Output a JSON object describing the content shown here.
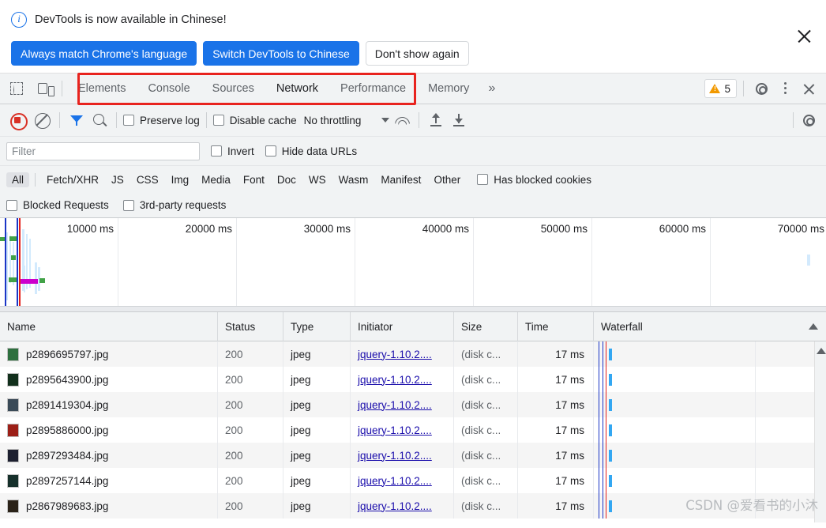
{
  "banner": {
    "message": "DevTools is now available in Chinese!",
    "info_icon": "info-icon",
    "primary_button": "Always match Chrome's language",
    "secondary_button": "Switch DevTools to Chinese",
    "dismiss_button": "Don't show again",
    "close_icon": "close-icon"
  },
  "tabbar": {
    "inspect_icon": "inspect-element-icon",
    "device_icon": "device-toolbar-icon",
    "tabs": [
      {
        "label": "Elements",
        "active": false
      },
      {
        "label": "Console",
        "active": false
      },
      {
        "label": "Sources",
        "active": false
      },
      {
        "label": "Network",
        "active": true
      },
      {
        "label": "Performance",
        "active": false
      },
      {
        "label": "Memory",
        "active": false
      }
    ],
    "more_tabs": "»",
    "warning_count": "5",
    "warning_icon": "warning-triangle-icon",
    "settings_icon": "gear-icon",
    "menu_icon": "kebab-menu-icon",
    "close_icon": "close-icon"
  },
  "network_toolbar": {
    "record_icon": "record-button-icon",
    "clear_icon": "clear-icon",
    "filter_icon": "filter-funnel-icon",
    "search_icon": "search-icon",
    "preserve_log": "Preserve log",
    "disable_cache": "Disable cache",
    "throttling": "No throttling",
    "throttle_caret": "chevron-down-icon",
    "network_conditions_icon": "wifi-icon",
    "import_icon": "import-har-icon",
    "export_icon": "export-har-icon",
    "settings_icon": "gear-icon"
  },
  "filter_row": {
    "placeholder": "Filter",
    "value": "",
    "invert": "Invert",
    "hide_data_urls": "Hide data URLs"
  },
  "type_filters": {
    "chips": [
      "All",
      "Fetch/XHR",
      "JS",
      "CSS",
      "Img",
      "Media",
      "Font",
      "Doc",
      "WS",
      "Wasm",
      "Manifest",
      "Other"
    ],
    "selected": "All",
    "has_blocked_cookies": "Has blocked cookies",
    "blocked_requests": "Blocked Requests",
    "third_party_requests": "3rd-party requests"
  },
  "overview": {
    "ticks": [
      "10000 ms",
      "20000 ms",
      "30000 ms",
      "40000 ms",
      "50000 ms",
      "60000 ms",
      "70000 ms"
    ]
  },
  "table": {
    "columns": [
      "Name",
      "Status",
      "Type",
      "Initiator",
      "Size",
      "Time",
      "Waterfall"
    ],
    "sort_icon": "sort-ascending-icon",
    "rows": [
      {
        "name": "p2896695797.jpg",
        "status": "200",
        "type": "jpeg",
        "initiator": "jquery-1.10.2....",
        "size": "(disk c...",
        "time": "17 ms",
        "thumb": "#2e6f3e"
      },
      {
        "name": "p2895643900.jpg",
        "status": "200",
        "type": "jpeg",
        "initiator": "jquery-1.10.2....",
        "size": "(disk c...",
        "time": "17 ms",
        "thumb": "#12301c"
      },
      {
        "name": "p2891419304.jpg",
        "status": "200",
        "type": "jpeg",
        "initiator": "jquery-1.10.2....",
        "size": "(disk c...",
        "time": "17 ms",
        "thumb": "#3a4a57"
      },
      {
        "name": "p2895886000.jpg",
        "status": "200",
        "type": "jpeg",
        "initiator": "jquery-1.10.2....",
        "size": "(disk c...",
        "time": "17 ms",
        "thumb": "#9c1f17"
      },
      {
        "name": "p2897293484.jpg",
        "status": "200",
        "type": "jpeg",
        "initiator": "jquery-1.10.2....",
        "size": "(disk c...",
        "time": "17 ms",
        "thumb": "#1d2030"
      },
      {
        "name": "p2897257144.jpg",
        "status": "200",
        "type": "jpeg",
        "initiator": "jquery-1.10.2....",
        "size": "(disk c...",
        "time": "17 ms",
        "thumb": "#16302b"
      },
      {
        "name": "p2867989683.jpg",
        "status": "200",
        "type": "jpeg",
        "initiator": "jquery-1.10.2....",
        "size": "(disk c...",
        "time": "17 ms",
        "thumb": "#2a2218"
      }
    ]
  },
  "watermark": "CSDN @爱看书的小沐",
  "colors": {
    "accent": "#1a73e8",
    "annotation": "#e8231e",
    "warning": "#f29900",
    "record": "#d93025",
    "waterfall_bar": "#33a7f2",
    "load_line": "#e4211c",
    "dcl_line": "#1a35c6"
  }
}
